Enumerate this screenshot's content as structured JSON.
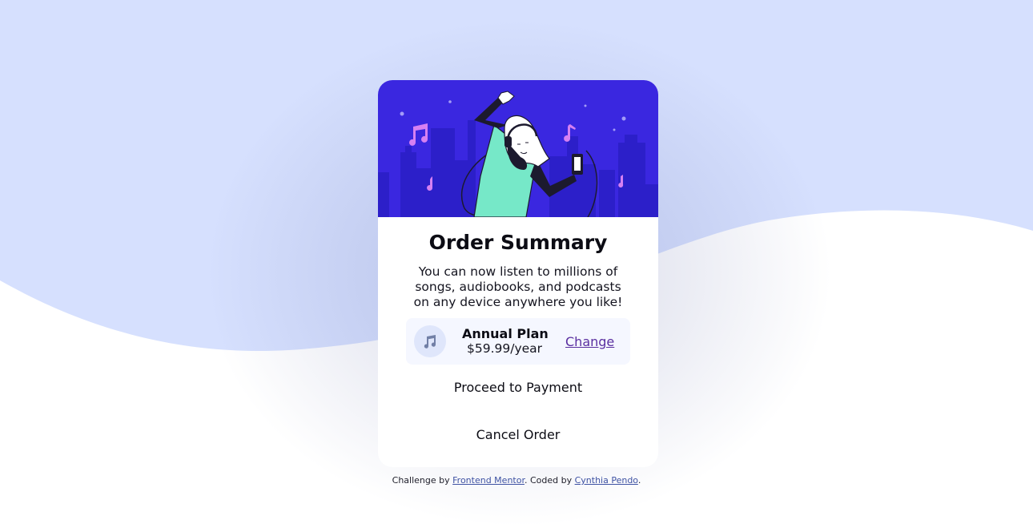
{
  "card": {
    "title": "Order Summary",
    "description": "You can now listen to millions of songs, audiobooks, and podcasts on any device anywhere you like!",
    "plan": {
      "icon": "music-note-icon",
      "name": "Annual Plan",
      "price": "$59.99/year",
      "change_label": "Change"
    },
    "proceed_label": "Proceed to Payment",
    "cancel_label": "Cancel Order"
  },
  "attribution": {
    "prefix": "Challenge by ",
    "link1": "Frontend Mentor",
    "middle": ". Coded by ",
    "link2": "Cynthia Pendo",
    "suffix": "."
  },
  "colors": {
    "background_wave": "#d6e0fe",
    "hero_bg": "#3a27e0",
    "plan_bg": "#f5f7ff",
    "link": "#5a2fa0"
  }
}
